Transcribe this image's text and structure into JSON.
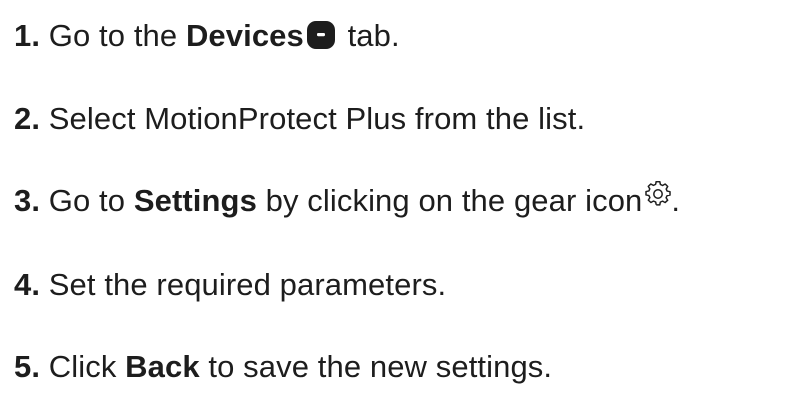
{
  "steps": [
    {
      "number": "1.",
      "t1": "Go to the",
      "bold": "Devices",
      "t2": "tab.",
      "icon": "devices-tab-icon"
    },
    {
      "number": "2.",
      "t1": "Select MotionProtect Plus from the list."
    },
    {
      "number": "3.",
      "t1": "Go to",
      "bold": "Settings",
      "t2": "by clicking on the gear icon",
      "t3": ".",
      "icon": "gear-icon"
    },
    {
      "number": "4.",
      "t1": "Set the required parameters."
    },
    {
      "number": "5.",
      "t1": "Click",
      "bold": "Back",
      "t2": "to save the new settings."
    }
  ],
  "colors": {
    "text": "#1d1d1d",
    "icon": "#1d1d1d",
    "background": "#ffffff"
  }
}
